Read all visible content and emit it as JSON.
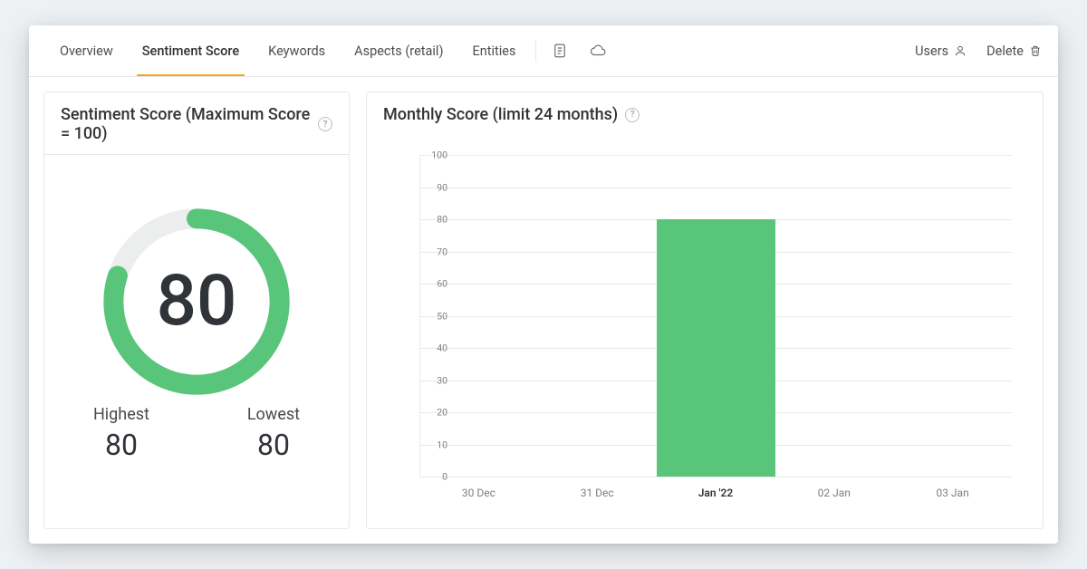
{
  "colors": {
    "accent": "#f6a623",
    "green": "#58c57a"
  },
  "topbar": {
    "tabs": [
      {
        "id": "overview",
        "label": "Overview"
      },
      {
        "id": "sentiment",
        "label": "Sentiment Score",
        "active": true
      },
      {
        "id": "keywords",
        "label": "Keywords"
      },
      {
        "id": "aspects",
        "label": "Aspects (retail)"
      },
      {
        "id": "entities",
        "label": "Entities"
      }
    ],
    "icons": [
      "document-icon",
      "cloud-icon"
    ],
    "actions": {
      "users": {
        "label": "Users"
      },
      "delete": {
        "label": "Delete"
      }
    }
  },
  "gauge": {
    "title": "Sentiment Score (Maximum Score = 100)",
    "value": 80,
    "max": 100,
    "highest_label": "Highest",
    "highest_value": "80",
    "lowest_label": "Lowest",
    "lowest_value": "80"
  },
  "monthly": {
    "title": "Monthly Score (limit 24 months)"
  },
  "chart_data": {
    "type": "bar",
    "title": "Monthly Score (limit 24 months)",
    "xlabel": "",
    "ylabel": "",
    "ylim": [
      0,
      100
    ],
    "y_ticks": [
      0,
      10,
      20,
      30,
      40,
      50,
      60,
      70,
      80,
      90,
      100
    ],
    "categories": [
      "30 Dec",
      "31 Dec",
      "Jan '22",
      "02 Jan",
      "03 Jan"
    ],
    "highlight_category": "Jan '22",
    "values": [
      0,
      0,
      80,
      0,
      0
    ]
  }
}
